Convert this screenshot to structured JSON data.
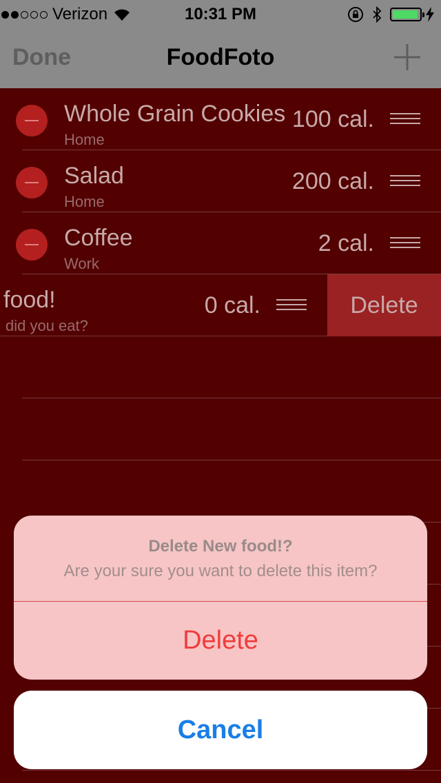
{
  "status_bar": {
    "carrier": "Verizon",
    "signal_bars_filled": 2,
    "signal_bars_total": 5,
    "time": "10:31 PM",
    "battery_level": 0.95,
    "icons": [
      "wifi-icon",
      "rotation-lock-icon",
      "bluetooth-icon",
      "battery-icon",
      "charging-bolt-icon"
    ]
  },
  "nav": {
    "done_label": "Done",
    "title": "FoodFoto",
    "add_icon": "plus-icon"
  },
  "rows": [
    {
      "name": "Whole Grain Cookies",
      "place": "Home",
      "calories": "100 cal."
    },
    {
      "name": "Salad",
      "place": "Home",
      "calories": "200 cal."
    },
    {
      "name": "Coffee",
      "place": "Work",
      "calories": "2 cal."
    }
  ],
  "swiped_row": {
    "name": "food!",
    "place": "did you eat?",
    "calories": "0 cal.",
    "delete_label": "Delete"
  },
  "action_sheet": {
    "title": "Delete New food!?",
    "message": "Are your sure you want to delete this item?",
    "delete_label": "Delete",
    "cancel_label": "Cancel"
  },
  "colors": {
    "list_background": "#520000",
    "bar_background": "#8a8a8a",
    "destructive": "#f03c3c",
    "cancel_blue": "#1a7ee6"
  }
}
